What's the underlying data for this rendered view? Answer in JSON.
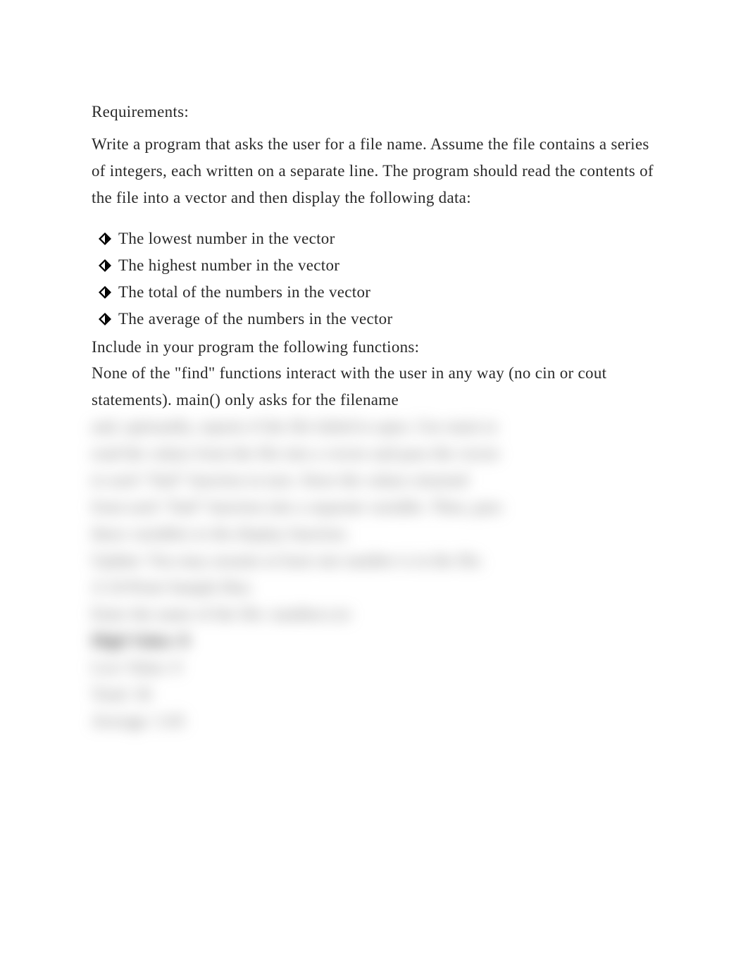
{
  "heading": "Requirements:",
  "intro": "Write a program that asks the user for a file name. Assume the file contains a series of integers, each written on a separate line. The program should read the contents of the file into a vector and then display the following data:",
  "bullets": [
    "The lowest number in the vector",
    "The highest number in the vector",
    "The total of the numbers in the vector",
    "The average of the numbers in the vector"
  ],
  "after_list_1": "Include in your program the following functions:",
  "after_list_2": "None of the \"find\" functions interact with the user in any way (no cin or cout statements). main() only asks for the filename",
  "blurred_lines": [
    "and, optionally, reports if the file failed to open. Use main to",
    "read the values from the file into a vector and pass the vector",
    "to each \"find\" function in turn. Store the values returned",
    "from each \"find\" function into a separate variable. Then, pass",
    "these variables to the display function.",
    "Update: You may assume at least one number is in the file.",
    "A 10-Point Sample Run",
    "Enter the name of the file: numbers.txt"
  ],
  "blurred_strong": "High Value: 8",
  "blurred_tail": [
    " Low Value: 0",
    " Total: 36",
    " Average: 3.45"
  ]
}
